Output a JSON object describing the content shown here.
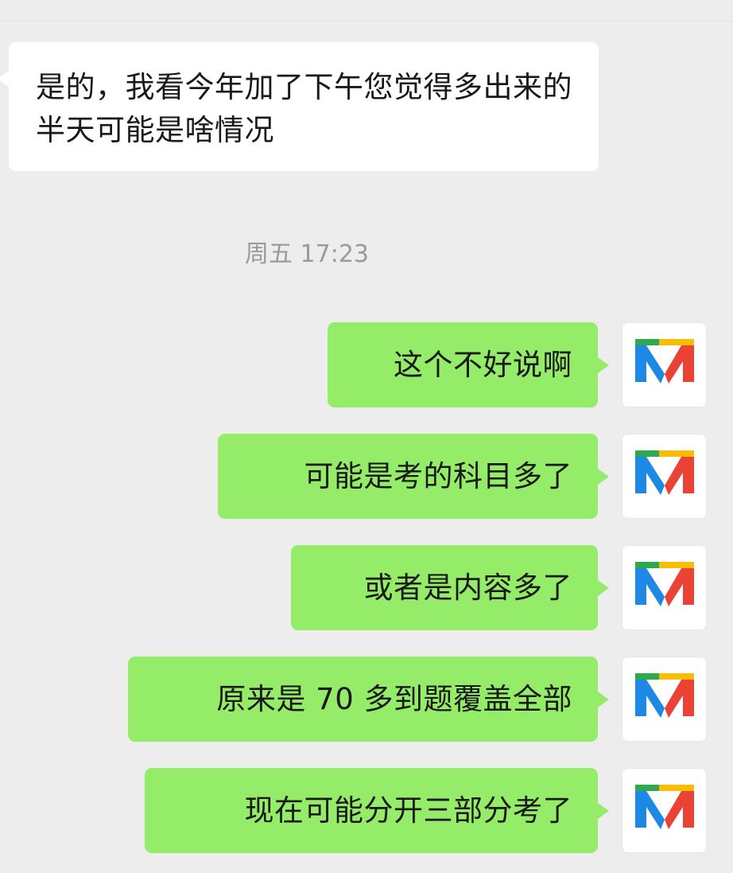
{
  "chat": {
    "incoming_message": "是的，我看今年加了下午您觉得多出来的半天可能是啥情况",
    "timestamp": "周五 17:23",
    "outgoing_messages": [
      "这个不好说啊",
      "可能是考的科目多了",
      "或者是内容多了",
      "原来是 70 多到题覆盖全部",
      "现在可能分开三部分考了"
    ],
    "avatar": {
      "icon": "m-logo-icon",
      "colors": {
        "green": "#2fa84f",
        "blue": "#1e88e5",
        "yellow": "#fbbc05",
        "red": "#ea4335"
      }
    }
  },
  "colors": {
    "background": "#ededed",
    "incoming_bubble": "#ffffff",
    "outgoing_bubble": "#95ec69",
    "timestamp_text": "#9a9a9a"
  }
}
